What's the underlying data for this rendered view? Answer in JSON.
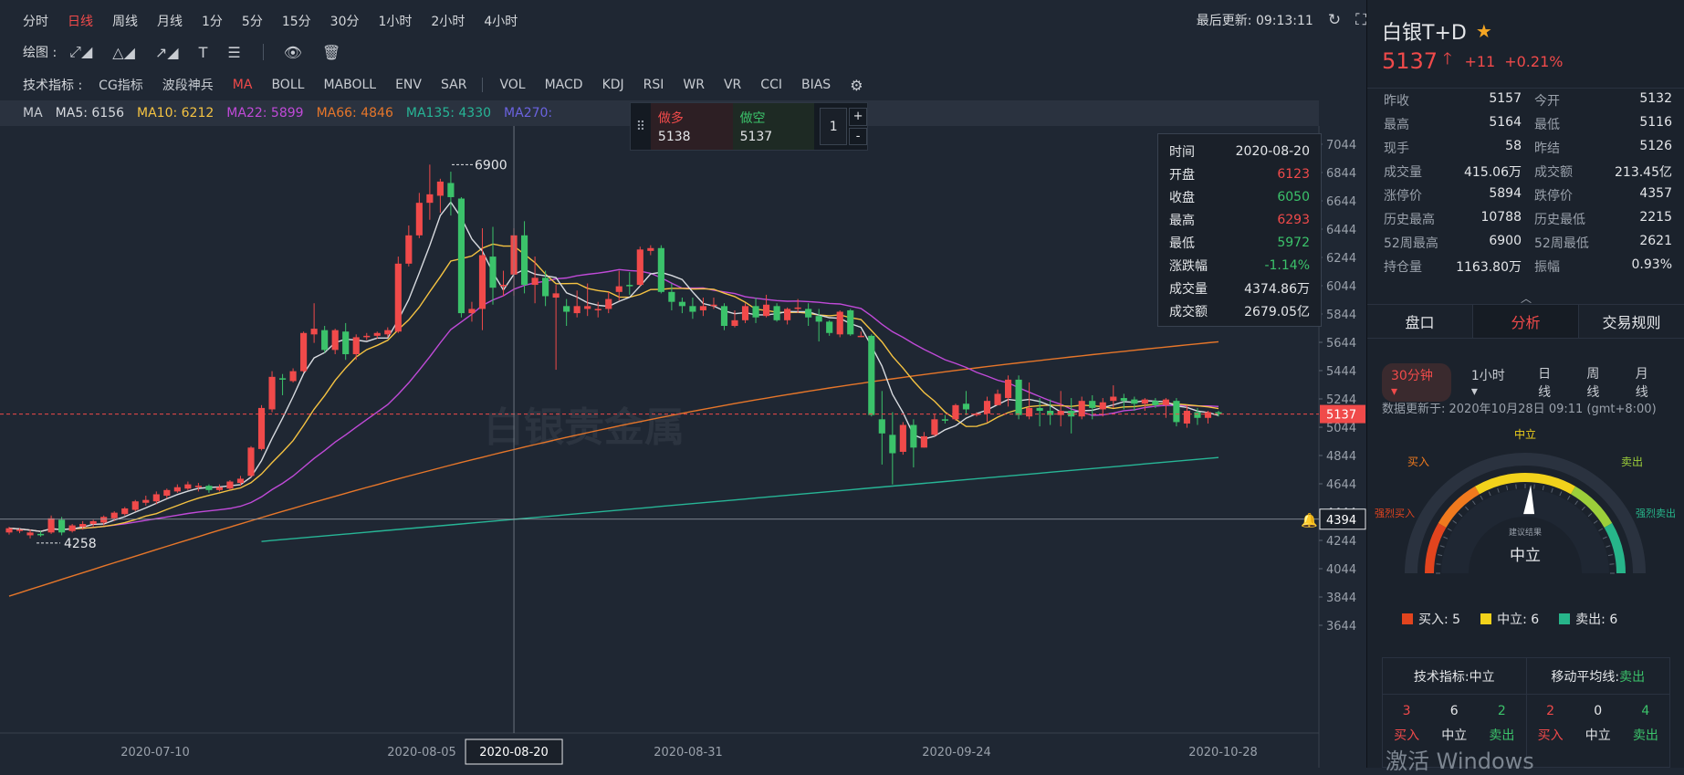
{
  "periods": [
    "分时",
    "日线",
    "周线",
    "月线",
    "1分",
    "5分",
    "15分",
    "30分",
    "1小时",
    "2小时",
    "4小时"
  ],
  "active_period": "日线",
  "last_update": "最后更新: 09:13:11",
  "draw_label": "绘图 :",
  "indicator_label": "技术指标 :",
  "indicators_main": [
    "CG指标",
    "波段神兵",
    "MA",
    "BOLL",
    "MABOLL",
    "ENV",
    "SAR"
  ],
  "indicators_sub": [
    "VOL",
    "MACD",
    "KDJ",
    "RSI",
    "WR",
    "VR",
    "CCI",
    "BIAS"
  ],
  "active_indicator": "MA",
  "ma_bar": {
    "ma": "MA",
    "ma5": "MA5: 6156",
    "ma10": "MA10: 6212",
    "ma22": "MA22: 5899",
    "ma66": "MA66: 4846",
    "ma135": "MA135: 4330",
    "ma270": "MA270:"
  },
  "colors": {
    "up": "#f04a4a",
    "down": "#3bc26a",
    "ma5": "#d8dbe0",
    "ma10": "#f5c342",
    "ma22": "#c04ad8",
    "ma66": "#e6762a",
    "ma135": "#27b596",
    "ma270": "#6b63e0",
    "bg": "#1f2733"
  },
  "trade": {
    "buy_label": "做多",
    "buy_price": "5138",
    "sell_label": "做空",
    "sell_price": "5137",
    "qty": "1",
    "plus": "+",
    "minus": "-"
  },
  "tooltip": {
    "rows": [
      {
        "k": "时间",
        "v": "2020-08-20",
        "c": "w"
      },
      {
        "k": "开盘",
        "v": "6123",
        "c": "r"
      },
      {
        "k": "收盘",
        "v": "6050",
        "c": "g"
      },
      {
        "k": "最高",
        "v": "6293",
        "c": "r"
      },
      {
        "k": "最低",
        "v": "5972",
        "c": "g"
      },
      {
        "k": "涨跌幅",
        "v": "-1.14%",
        "c": "g"
      },
      {
        "k": "成交量",
        "v": "4374.86万",
        "c": "w"
      },
      {
        "k": "成交额",
        "v": "2679.05亿",
        "c": "w"
      }
    ]
  },
  "chart_data": {
    "type": "candlestick",
    "y_ticks": [
      7044,
      6844,
      6644,
      6444,
      6244,
      6044,
      5844,
      5644,
      5444,
      5244,
      5044,
      4844,
      4644,
      4444,
      4244,
      4044,
      3844,
      3644
    ],
    "x_ticks": [
      "2020-07-10",
      "2020-08-05",
      "2020-08-20",
      "2020-08-31",
      "2020-09-24",
      "2020-10-28"
    ],
    "highlighted_x": "2020-08-20",
    "current_price": "5137",
    "crosshair_price": "4394",
    "max_label": "6900",
    "min_label": "4258",
    "watermark": "白银贵金属",
    "candles": [
      [
        4300,
        4330,
        4285,
        4340
      ],
      [
        4310,
        4320,
        4295,
        4330
      ],
      [
        4280,
        4300,
        4258,
        4320
      ],
      [
        4290,
        4280,
        4270,
        4310
      ],
      [
        4300,
        4400,
        4290,
        4420
      ],
      [
        4390,
        4300,
        4280,
        4410
      ],
      [
        4310,
        4350,
        4300,
        4360
      ],
      [
        4340,
        4360,
        4320,
        4380
      ],
      [
        4360,
        4380,
        4340,
        4390
      ],
      [
        4370,
        4410,
        4350,
        4420
      ],
      [
        4400,
        4440,
        4380,
        4450
      ],
      [
        4430,
        4470,
        4420,
        4480
      ],
      [
        4460,
        4520,
        4450,
        4530
      ],
      [
        4510,
        4530,
        4490,
        4560
      ],
      [
        4520,
        4570,
        4500,
        4590
      ],
      [
        4560,
        4600,
        4540,
        4610
      ],
      [
        4590,
        4620,
        4580,
        4640
      ],
      [
        4610,
        4640,
        4600,
        4660
      ],
      [
        4620,
        4630,
        4590,
        4650
      ],
      [
        4630,
        4600,
        4580,
        4640
      ],
      [
        4600,
        4620,
        4590,
        4640
      ],
      [
        4610,
        4660,
        4600,
        4670
      ],
      [
        4650,
        4680,
        4630,
        4700
      ],
      [
        4700,
        4900,
        4690,
        4910
      ],
      [
        4890,
        5180,
        4880,
        5200
      ],
      [
        5170,
        5400,
        5150,
        5440
      ],
      [
        5390,
        5380,
        5270,
        5420
      ],
      [
        5370,
        5440,
        5360,
        5460
      ],
      [
        5440,
        5710,
        5430,
        5720
      ],
      [
        5700,
        5740,
        5640,
        5920
      ],
      [
        5730,
        5590,
        5570,
        5760
      ],
      [
        5590,
        5730,
        5560,
        5740
      ],
      [
        5720,
        5560,
        5520,
        5780
      ],
      [
        5560,
        5680,
        5520,
        5700
      ],
      [
        5680,
        5690,
        5660,
        5710
      ],
      [
        5690,
        5710,
        5670,
        5720
      ],
      [
        5700,
        5730,
        5680,
        5750
      ],
      [
        5720,
        6200,
        5710,
        6250
      ],
      [
        6200,
        6400,
        6180,
        6470
      ],
      [
        6400,
        6630,
        6380,
        6700
      ],
      [
        6630,
        6690,
        6510,
        6900
      ],
      [
        6680,
        6780,
        6560,
        6800
      ],
      [
        6770,
        6670,
        6540,
        6850
      ],
      [
        6660,
        5850,
        5820,
        6670
      ],
      [
        5850,
        5880,
        5790,
        5930
      ],
      [
        5880,
        6260,
        5730,
        6450
      ],
      [
        6250,
        6030,
        5910,
        6460
      ],
      [
        6040,
        6050,
        5970,
        6150
      ],
      [
        6123,
        6400,
        5972,
        6450
      ],
      [
        6400,
        6050,
        5990,
        6500
      ],
      [
        6050,
        6100,
        5920,
        6250
      ],
      [
        6100,
        5970,
        5900,
        6150
      ],
      [
        5960,
        5990,
        5450,
        6050
      ],
      [
        5900,
        5860,
        5760,
        5950
      ],
      [
        5850,
        5900,
        5820,
        6010
      ],
      [
        5880,
        5900,
        5830,
        6060
      ],
      [
        5870,
        5880,
        5820,
        5930
      ],
      [
        5880,
        5950,
        5850,
        6000
      ],
      [
        6000,
        6040,
        5940,
        6150
      ],
      [
        6050,
        6040,
        5980,
        6140
      ],
      [
        6050,
        6300,
        6040,
        6320
      ],
      [
        6290,
        6310,
        6260,
        6330
      ],
      [
        6310,
        6000,
        5990,
        6330
      ],
      [
        6000,
        5930,
        5870,
        6060
      ],
      [
        5930,
        5900,
        5850,
        5960
      ],
      [
        5900,
        5860,
        5810,
        5960
      ],
      [
        5870,
        5900,
        5830,
        5960
      ],
      [
        5900,
        5910,
        5880,
        5960
      ],
      [
        5900,
        5760,
        5730,
        5920
      ],
      [
        5760,
        5800,
        5750,
        5870
      ],
      [
        5800,
        5900,
        5780,
        5920
      ],
      [
        5900,
        5820,
        5780,
        5960
      ],
      [
        5830,
        5910,
        5820,
        5980
      ],
      [
        5900,
        5800,
        5790,
        5920
      ],
      [
        5800,
        5880,
        5770,
        5890
      ],
      [
        5880,
        5890,
        5850,
        5950
      ],
      [
        5880,
        5820,
        5760,
        5920
      ],
      [
        5830,
        5790,
        5650,
        5880
      ],
      [
        5790,
        5710,
        5690,
        5800
      ],
      [
        5700,
        5860,
        5680,
        5870
      ],
      [
        5870,
        5700,
        5690,
        5880
      ],
      [
        5690,
        5690,
        5680,
        5720
      ],
      [
        5690,
        5130,
        5120,
        5700
      ],
      [
        5100,
        5000,
        4780,
        5300
      ],
      [
        4990,
        4860,
        4640,
        5150
      ],
      [
        4870,
        5060,
        4850,
        5080
      ],
      [
        5060,
        4900,
        4760,
        5100
      ],
      [
        4900,
        4980,
        4900,
        5010
      ],
      [
        4990,
        5100,
        4980,
        5140
      ],
      [
        5100,
        5090,
        5070,
        5130
      ],
      [
        5100,
        5200,
        5090,
        5210
      ],
      [
        5210,
        5170,
        5130,
        5300
      ],
      [
        5130,
        5140,
        5120,
        5150
      ],
      [
        5140,
        5230,
        5080,
        5260
      ],
      [
        5200,
        5280,
        5200,
        5310
      ],
      [
        5250,
        5380,
        5190,
        5410
      ],
      [
        5380,
        5130,
        5100,
        5410
      ],
      [
        5120,
        5180,
        5100,
        5360
      ],
      [
        5180,
        5160,
        5050,
        5250
      ],
      [
        5160,
        5130,
        5060,
        5240
      ],
      [
        5130,
        5160,
        5050,
        5300
      ],
      [
        5160,
        5120,
        5000,
        5250
      ],
      [
        5120,
        5230,
        5100,
        5260
      ],
      [
        5230,
        5180,
        5100,
        5270
      ],
      [
        5170,
        5220,
        5120,
        5250
      ],
      [
        5230,
        5260,
        5180,
        5340
      ],
      [
        5250,
        5230,
        5170,
        5280
      ],
      [
        5240,
        5210,
        5160,
        5260
      ],
      [
        5210,
        5240,
        5160,
        5250
      ],
      [
        5230,
        5200,
        5180,
        5250
      ],
      [
        5200,
        5240,
        5110,
        5250
      ],
      [
        5230,
        5080,
        5050,
        5250
      ],
      [
        5070,
        5160,
        5040,
        5200
      ],
      [
        5150,
        5110,
        5060,
        5180
      ],
      [
        5110,
        5150,
        5070,
        5160
      ],
      [
        5150,
        5137,
        5120,
        5160
      ]
    ]
  },
  "right": {
    "title": "白银T+D",
    "star": "★",
    "price": "5137",
    "arrow": "🡑",
    "change": "+11",
    "pct": "+0.21%",
    "stats": [
      [
        {
          "k": "昨收",
          "v": "5157",
          "c": "w"
        },
        {
          "k": "今开",
          "v": "5132",
          "c": "w"
        }
      ],
      [
        {
          "k": "最高",
          "v": "5164",
          "c": "w"
        },
        {
          "k": "最低",
          "v": "5116",
          "c": "w"
        }
      ],
      [
        {
          "k": "现手",
          "v": "58",
          "c": "w"
        },
        {
          "k": "昨结",
          "v": "5126",
          "c": "w"
        }
      ],
      [
        {
          "k": "成交量",
          "v": "415.06万",
          "c": "w"
        },
        {
          "k": "成交额",
          "v": "213.45亿",
          "c": "w"
        }
      ],
      [
        {
          "k": "涨停价",
          "v": "5894",
          "c": "w"
        },
        {
          "k": "跌停价",
          "v": "4357",
          "c": "w"
        }
      ],
      [
        {
          "k": "历史最高",
          "v": "10788",
          "c": "w"
        },
        {
          "k": "历史最低",
          "v": "2215",
          "c": "w"
        }
      ],
      [
        {
          "k": "52周最高",
          "v": "6900",
          "c": "w"
        },
        {
          "k": "52周最低",
          "v": "2621",
          "c": "w"
        }
      ],
      [
        {
          "k": "持仓量",
          "v": "1163.80万",
          "c": "w"
        },
        {
          "k": "振幅",
          "v": "0.93%",
          "c": "w"
        }
      ]
    ],
    "collapse": "︿",
    "tabs": [
      "盘口",
      "分析",
      "交易规则"
    ],
    "active_tab": "分析",
    "period_tabs": [
      "30分钟 ▾",
      "1小时 ▾",
      "日线",
      "周线",
      "月线"
    ],
    "update_line": "数据更新于: 2020年10月28日 09:11 (gmt+8:00)",
    "gauge": {
      "top": "中立",
      "left_mid": "买入",
      "right_mid": "卖出",
      "left_low": "强烈买入",
      "right_low": "强烈卖出",
      "sub": "建议结果",
      "result": "中立",
      "needle_level": 0.52
    },
    "counts": [
      {
        "label": "买入: 5",
        "color": "#e2441e"
      },
      {
        "label": "中立: 6",
        "color": "#f2d21b"
      },
      {
        "label": "卖出: 6",
        "color": "#27b58a"
      }
    ],
    "summary": [
      {
        "title": "技术指标: ",
        "status": "中立",
        "status_color": "w",
        "nums": [
          "3",
          "6",
          "2"
        ],
        "labs": [
          "买入",
          "中立",
          "卖出"
        ]
      },
      {
        "title": "移动平均线: ",
        "status": "卖出",
        "status_color": "g",
        "nums": [
          "2",
          "0",
          "4"
        ],
        "labs": [
          "买入",
          "中立",
          "卖出"
        ]
      }
    ]
  },
  "watermark_windows": "激活 Windows"
}
